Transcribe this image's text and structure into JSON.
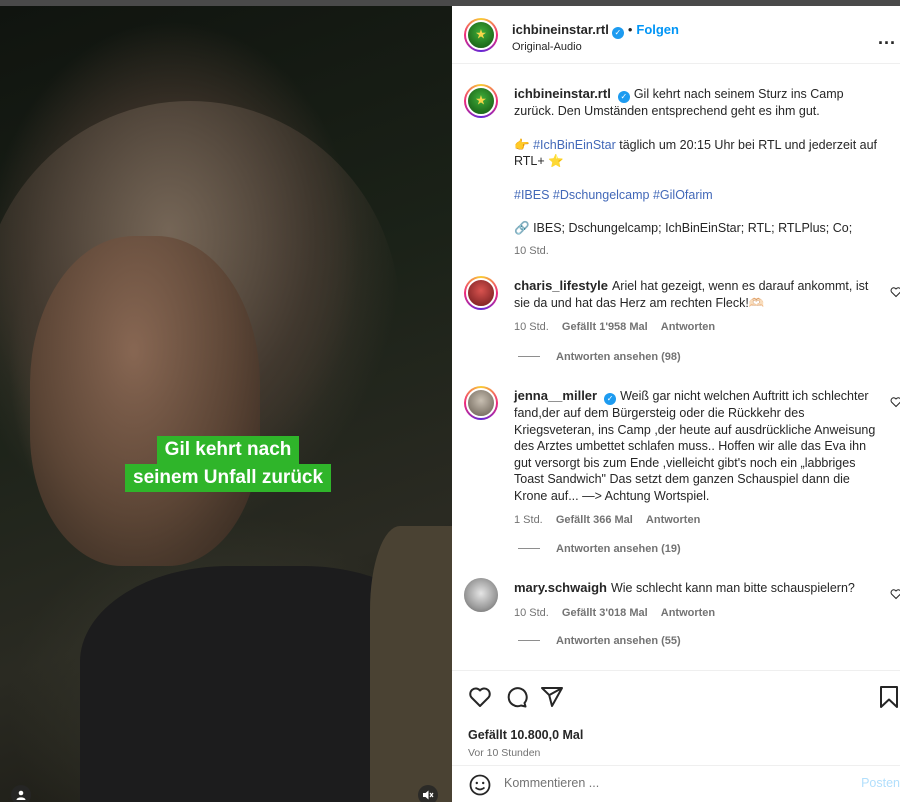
{
  "media": {
    "caption_lines": [
      "Gil kehrt nach",
      "seinem Unfall zurück"
    ],
    "user_icon": "user-icon",
    "mute_icon": "mute-icon"
  },
  "header": {
    "username": "ichbineinstar.rtl",
    "follow_label": "Folgen",
    "audio": "Original-Audio",
    "more_icon": "more-options-icon",
    "more_label": "..."
  },
  "post": {
    "username": "ichbineinstar.rtl",
    "text_1": "Gil kehrt nach seinem Sturz ins Camp zurück. Den Umständen entsprechend geht es ihm gut.",
    "text_2_emoji": "👉",
    "text_2_tag": "#IchBinEinStar",
    "text_2_rest": " täglich um 20:15 Uhr bei RTL und jederzeit auf RTL+ ",
    "text_2_star": "⭐",
    "hashtags": "#IBES #Dschungelcamp #GilOfarim",
    "sponsor": "IBES; Dschungelcamp; IchBinEinStar; RTL; RTLPlus; Co;",
    "time": "10 Std."
  },
  "comments": [
    {
      "username": "charis_lifestyle",
      "text": "Ariel hat gezeigt, wenn es darauf ankommt, ist sie da und hat das Herz am rechten Fleck!🫶🏻",
      "time": "10 Std.",
      "likes": "Gefällt 1'958 Mal",
      "reply": "Antworten",
      "replies": "Antworten ansehen (98)"
    },
    {
      "username": "jenna__miller",
      "text": "Weiß gar nicht welchen Auftritt ich schlechter fand,der auf dem Bürgersteig oder die Rückkehr des Kriegsveteran, ins Camp ,der heute auf ausdrückliche Anweisung des Arztes umbettet schlafen muss.. Hoffen wir alle das Eva ihn gut versorgt bis zum Ende ,vielleicht gibt's noch ein „labbriges Toast Sandwich\" Das setzt dem ganzen Schauspiel dann die Krone auf... —> Achtung Wortspiel.",
      "time": "1 Std.",
      "likes": "Gefällt 366 Mal",
      "reply": "Antworten",
      "replies": "Antworten ansehen (19)"
    },
    {
      "username": "mary.schwaigh",
      "text": "Wie schlecht kann man bitte schauspielern?",
      "time": "10 Std.",
      "likes": "Gefällt 3'018 Mal",
      "reply": "Antworten",
      "replies": "Antworten ansehen (55)"
    }
  ],
  "actions": {
    "like_icon": "heart-icon",
    "comment_icon": "comment-icon",
    "share_icon": "share-icon",
    "save_icon": "bookmark-icon",
    "likes": "Gefällt 10.800,0 Mal",
    "time": "Vor 10 Stunden"
  },
  "composer": {
    "emoji_icon": "emoji-icon",
    "placeholder": "Kommentieren ...",
    "post_label": "Posten"
  },
  "colors": {
    "caption_green": "#2fb52a",
    "link_blue": "#0095f6",
    "hashtag_blue": "#4268b8"
  }
}
